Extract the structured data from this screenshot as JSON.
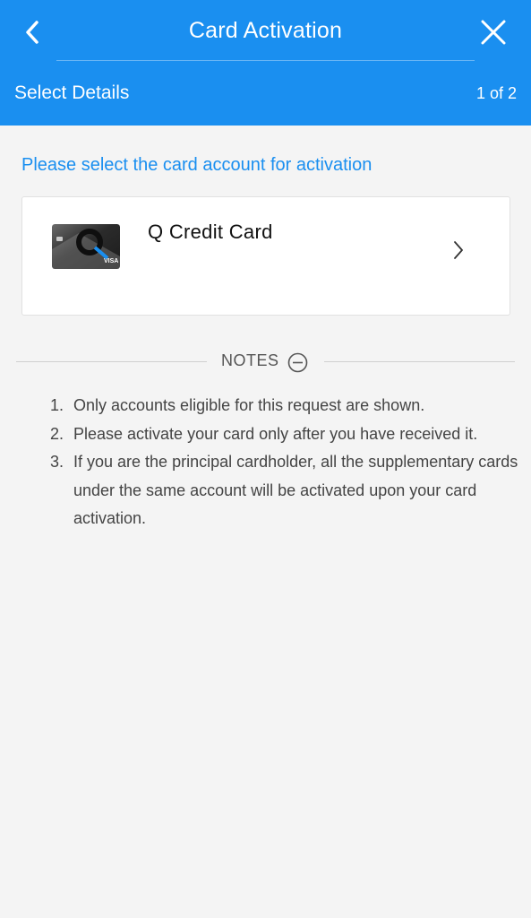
{
  "header": {
    "title": "Card Activation",
    "subtitle": "Select Details",
    "step": "1 of 2",
    "back_icon": "chevron-left-icon",
    "close_icon": "close-icon",
    "background_color": "#1a8ff0"
  },
  "main": {
    "prompt": "Please select the card account for activation",
    "prompt_color": "#1a8ff0",
    "card": {
      "name": "Q Credit Card",
      "network": "VISA",
      "chevron_icon": "chevron-right-icon"
    }
  },
  "notes": {
    "label": "NOTES",
    "toggle_icon": "minus-circle-icon",
    "items": [
      {
        "num": "1.",
        "text": "Only accounts eligible for this request are shown."
      },
      {
        "num": "2.",
        "text": "Please activate your card only after you have received it."
      },
      {
        "num": "3.",
        "text": "If you are the principal cardholder, all the supplementary cards under the same account will be activated upon your card activation."
      }
    ]
  }
}
